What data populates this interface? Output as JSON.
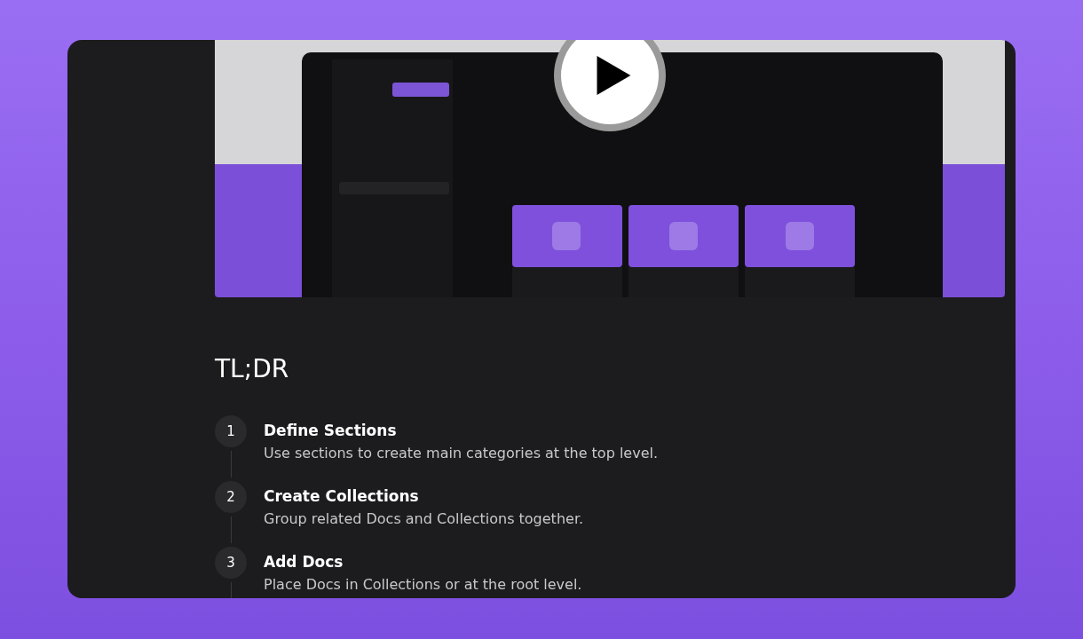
{
  "video": {
    "kind": "picture",
    "play_button": true
  },
  "heading": "TL;DR",
  "steps": [
    {
      "number": "1",
      "title": "Define Sections",
      "description": "Use sections to create main categories at the top level."
    },
    {
      "number": "2",
      "title": "Create Collections",
      "description": "Group related Docs and Collections together."
    },
    {
      "number": "3",
      "title": "Add Docs",
      "description": "Place Docs in Collections or at the root level."
    }
  ]
}
